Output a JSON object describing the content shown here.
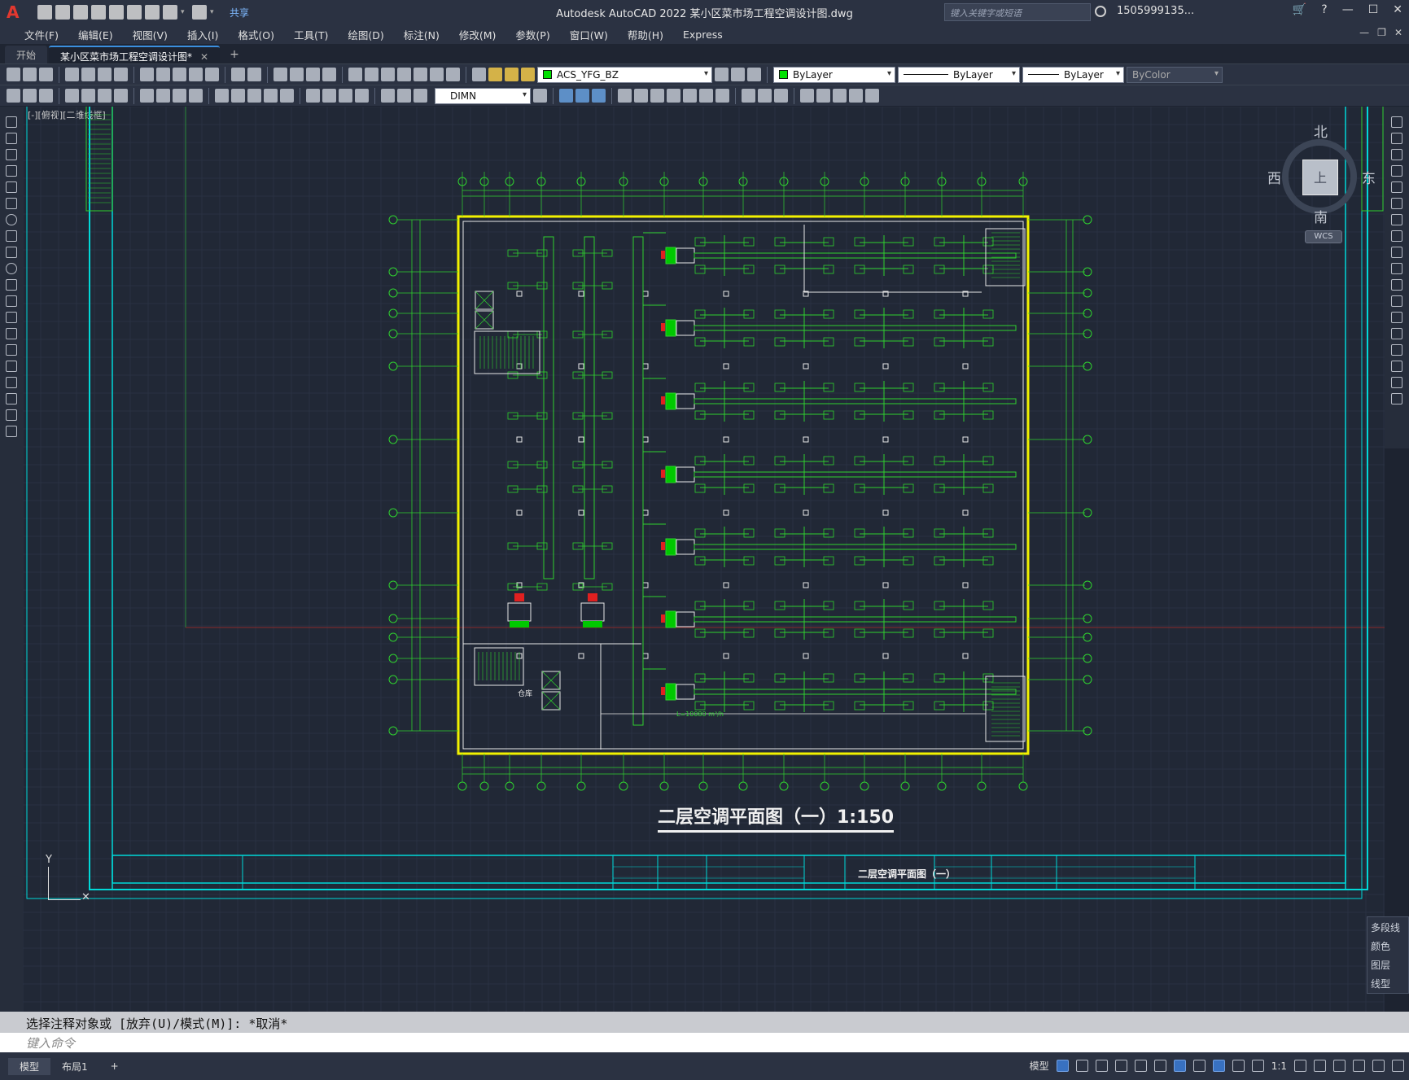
{
  "app": {
    "logo": "A",
    "window_title": "Autodesk AutoCAD 2022    某小区菜市场工程空调设计图.dwg",
    "share_label": "共享",
    "search_placeholder": "键入关键字或短语",
    "user": "1505999135...",
    "help": "?"
  },
  "menu": [
    "文件(F)",
    "编辑(E)",
    "视图(V)",
    "插入(I)",
    "格式(O)",
    "工具(T)",
    "绘图(D)",
    "标注(N)",
    "修改(M)",
    "参数(P)",
    "窗口(W)",
    "帮助(H)",
    "Express"
  ],
  "tabs": [
    {
      "label": "开始"
    },
    {
      "label": "某小区菜市场工程空调设计图*",
      "close": "✕"
    }
  ],
  "tab_add": "+",
  "properties_toolbar": {
    "layer": "ACS_YFG_BZ",
    "color": "ByLayer",
    "linetype": "ByLayer",
    "lineweight": "ByLayer",
    "plotstyle": "ByColor",
    "dimstyle": "DIMN"
  },
  "viewport_label": "[-][俯视][二维线框]",
  "viewcube": {
    "north": "北",
    "south": "南",
    "west": "西",
    "east": "东",
    "face": "上",
    "wcs": "WCS"
  },
  "drawing": {
    "title": "二层空调平面图（一）1:150",
    "titleblock_name": "二层空调平面图（一）",
    "note_airflow": "L=10080 m³/h",
    "room_label": "仓库"
  },
  "properties_panel": {
    "header": "多段线",
    "rows": [
      "颜色",
      "图层",
      "线型"
    ]
  },
  "command": {
    "history": "选择注释对象或 [放弃(U)/模式(M)]: *取消*",
    "placeholder": "键入命令"
  },
  "status": {
    "layout_tabs": [
      "模型",
      "布局1"
    ],
    "add": "+",
    "model_label": "模型",
    "scale": "1:1"
  },
  "colors": {
    "grid_green": "#2fd12f",
    "wall_yellow": "#f2f200",
    "frame_cyan": "#00d8d8",
    "canvas_bg": "#212836"
  }
}
